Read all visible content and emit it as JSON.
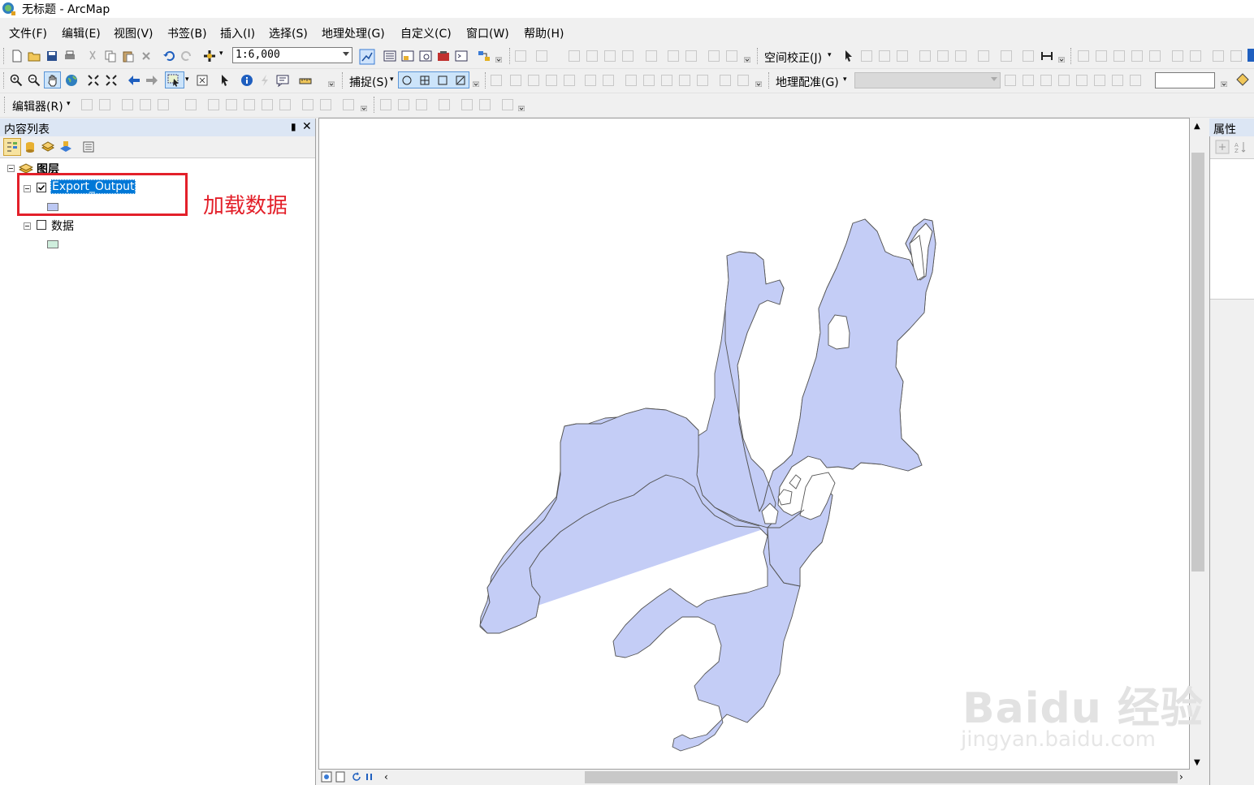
{
  "window": {
    "title": "无标题 - ArcMap"
  },
  "menu": [
    "文件(F)",
    "编辑(E)",
    "视图(V)",
    "书签(B)",
    "插入(I)",
    "选择(S)",
    "地理处理(G)",
    "自定义(C)",
    "窗口(W)",
    "帮助(H)"
  ],
  "toolbar": {
    "scale_value": "1:6,000",
    "spatial_adjust_label": "空间校正(J)",
    "snapping_label": "捕捉(S)",
    "georef_label": "地理配准(G)",
    "editor_label": "编辑器(R)"
  },
  "toc": {
    "title": "内容列表",
    "pin": "ᵽ",
    "close": "✕",
    "root_label": "图层",
    "layers": [
      {
        "name": "Export_Output",
        "checked": true,
        "selected": true,
        "swatch_color": "#bcc8f3"
      },
      {
        "name": "数据",
        "checked": false,
        "selected": false,
        "swatch_color": "#cfeedd"
      }
    ]
  },
  "annotation": {
    "text": "加载数据",
    "color": "#e3202a"
  },
  "properties": {
    "title": "属性"
  },
  "map": {
    "polygon_fill": "#c4cdf6",
    "polygon_stroke": "#555555"
  },
  "watermark": {
    "main": "Baidu 经验",
    "sub": "jingyan.baidu.com"
  },
  "icons": [
    "new-icon",
    "open-icon",
    "save-icon",
    "print-icon",
    "cut-icon",
    "copy-icon",
    "paste-icon",
    "delete-icon",
    "undo-icon",
    "redo-icon",
    "add-data-icon",
    "zoom-in-icon",
    "zoom-out-icon",
    "pan-icon",
    "globe-icon",
    "full-extent-icon",
    "back-icon",
    "forward-icon",
    "select-features-icon",
    "select-element-icon",
    "identify-icon",
    "search-icon",
    "arrow-pointer-icon"
  ]
}
